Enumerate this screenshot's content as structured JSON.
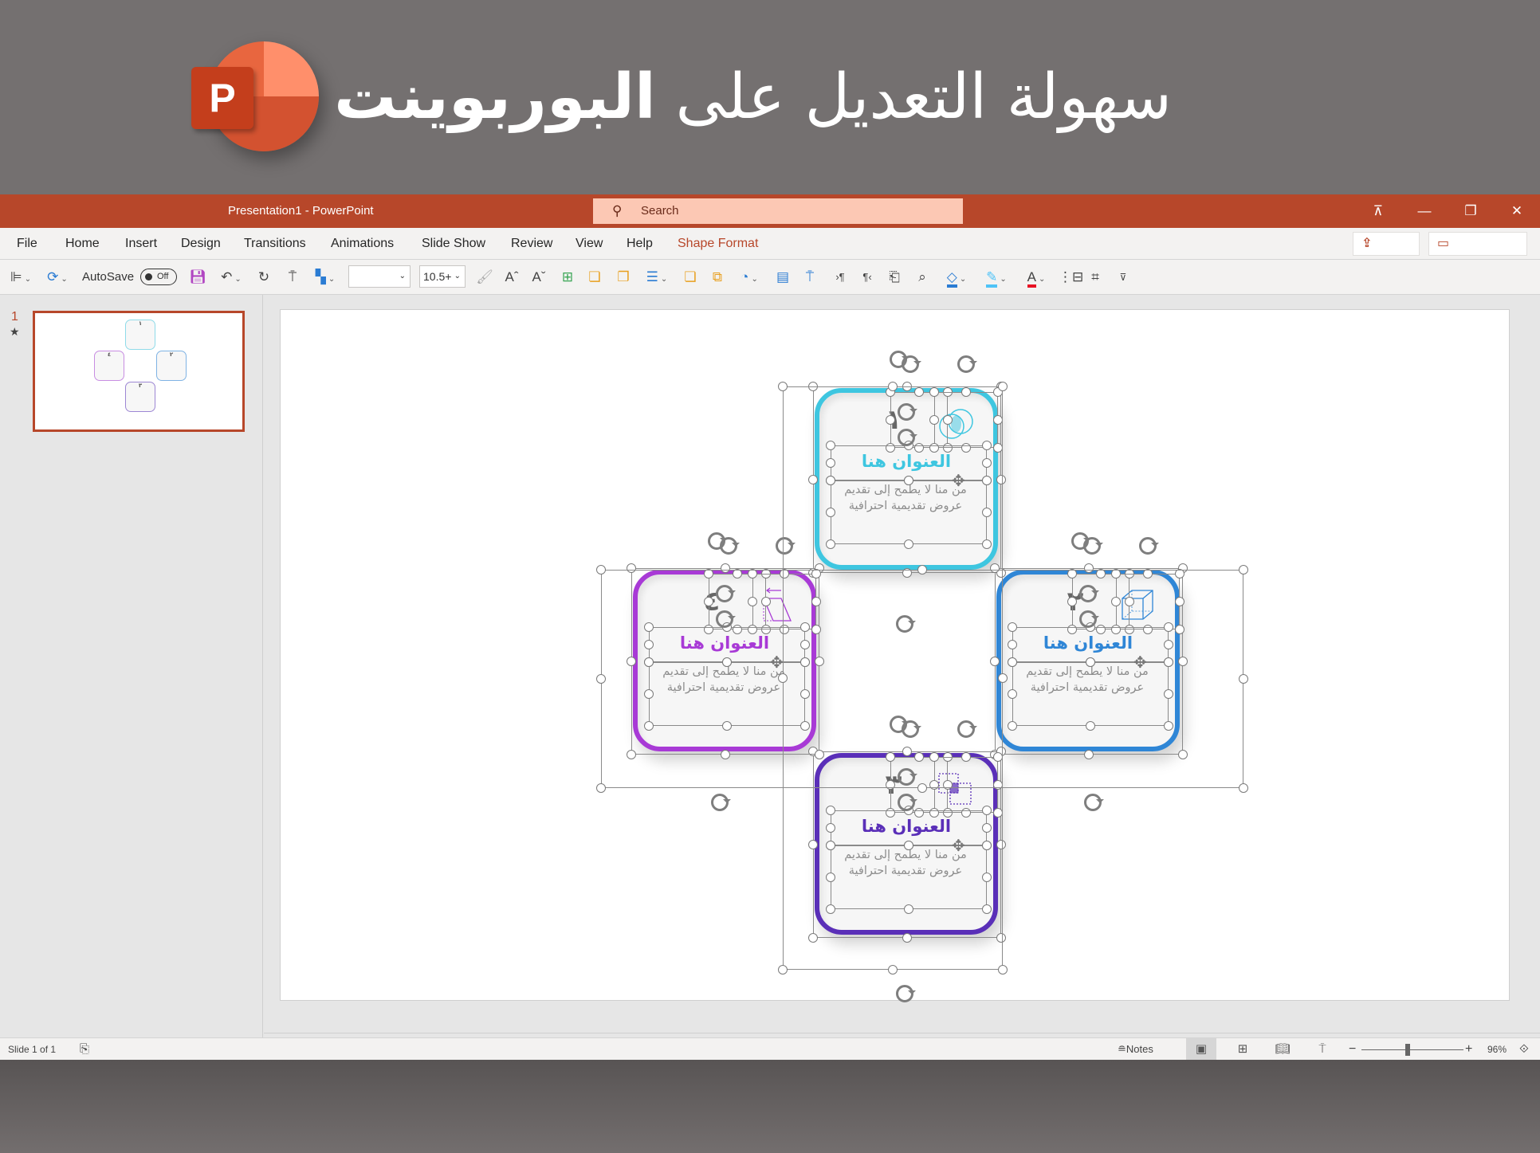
{
  "banner": {
    "title_regular": "سهولة التعديل على ",
    "title_bold": "البوربوينت",
    "logo_letter": "P"
  },
  "titlebar": {
    "document_title": "Presentation1  -  PowerPoint",
    "search_placeholder": "Search",
    "controls": [
      "ribbon-display-icon",
      "minimize-icon",
      "restore-icon",
      "close-icon"
    ],
    "control_glyphs": [
      "⊼",
      "—",
      "❐",
      "✕"
    ]
  },
  "menu": {
    "items": [
      "File",
      "Home",
      "Insert",
      "Design",
      "Transitions",
      "Animations",
      "Slide Show",
      "Review",
      "View",
      "Help",
      "Shape Format"
    ],
    "active": "Shape Format",
    "share_label": "Share",
    "comments_label": "Comments"
  },
  "toolbar": {
    "autosave_label": "AutoSave",
    "autosave_state": "Off",
    "font_name_value": "",
    "font_size_value": "10.5+",
    "accent_colors": {
      "fill": "#2b7cd3",
      "outline": "#4fc3f7",
      "font": "#e81123",
      "save": "#b146c2"
    }
  },
  "thumbnails": {
    "slide_number": "1",
    "has_animation": true
  },
  "slide": {
    "cards": [
      {
        "id": "card-1",
        "number": "١",
        "title": "العنوان هنا",
        "body": "من منا لا يطمح إلى تقديم عروض تقديمية احترافية",
        "color": "#3ec6e0",
        "icon": "venn-icon"
      },
      {
        "id": "card-2",
        "number": "٢",
        "title": "العنوان هنا",
        "body": "من منا لا يطمح إلى تقديم عروض تقديمية احترافية",
        "color": "#2f86d6",
        "icon": "cube-icon"
      },
      {
        "id": "card-3",
        "number": "٣",
        "title": "العنوان هنا",
        "body": "من منا لا يطمح إلى تقديم عروض تقديمية احترافية",
        "color": "#5a2fb8",
        "icon": "overlap-squares-icon"
      },
      {
        "id": "card-4",
        "number": "٤",
        "title": "العنوان هنا",
        "body": "من منا لا يطمح إلى تقديم عروض تقديمية احترافية",
        "color": "#a83ad6",
        "icon": "parallelogram-icon"
      }
    ]
  },
  "statusbar": {
    "slide_indicator": "Slide 1 of 1",
    "notes_label": "Notes",
    "zoom_level": "96%",
    "zoom_fraction": 0.45,
    "active_view": "normal"
  }
}
